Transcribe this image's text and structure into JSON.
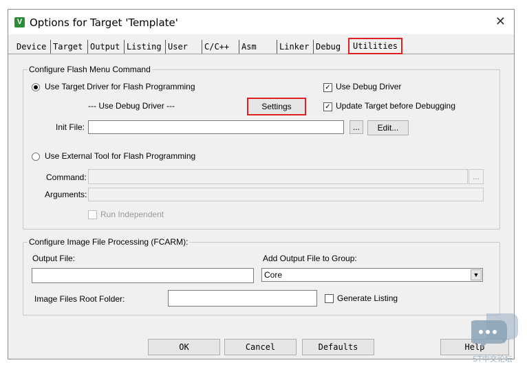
{
  "window": {
    "title": "Options for Target 'Template'",
    "app_icon": "V",
    "close_glyph": "✕"
  },
  "tabs": [
    "Device",
    "Target",
    "Output",
    "Listing",
    "User",
    "C/C++",
    "Asm",
    "Linker",
    "Debug",
    "Utilities"
  ],
  "flash_group": {
    "legend": "Configure Flash Menu Command",
    "use_target_driver": "Use Target Driver for Flash Programming",
    "driver_value": "--- Use Debug Driver ---",
    "settings_label": "Settings",
    "use_debug_driver": "Use Debug Driver",
    "update_target": "Update Target before Debugging",
    "init_file_label": "Init File:",
    "init_file_value": "",
    "browse_label": "...",
    "edit_label": "Edit...",
    "use_external_tool": "Use External Tool for Flash Programming",
    "command_label": "Command:",
    "command_value": "",
    "arguments_label": "Arguments:",
    "arguments_value": "",
    "run_independent": "Run Independent"
  },
  "image_group": {
    "legend": "Configure Image File Processing (FCARM):",
    "output_file_label": "Output File:",
    "output_file_value": "",
    "add_output_label": "Add Output File  to Group:",
    "group_value": "Core",
    "root_folder_label": "Image Files Root Folder:",
    "root_folder_value": "",
    "generate_listing": "Generate Listing"
  },
  "footer": {
    "ok": "OK",
    "cancel": "Cancel",
    "defaults": "Defaults",
    "help": "Help"
  },
  "watermark": {
    "text": "ST中文论坛"
  },
  "colors": {
    "highlight": "#e02020",
    "dialog_bg": "#f0f0f0"
  }
}
